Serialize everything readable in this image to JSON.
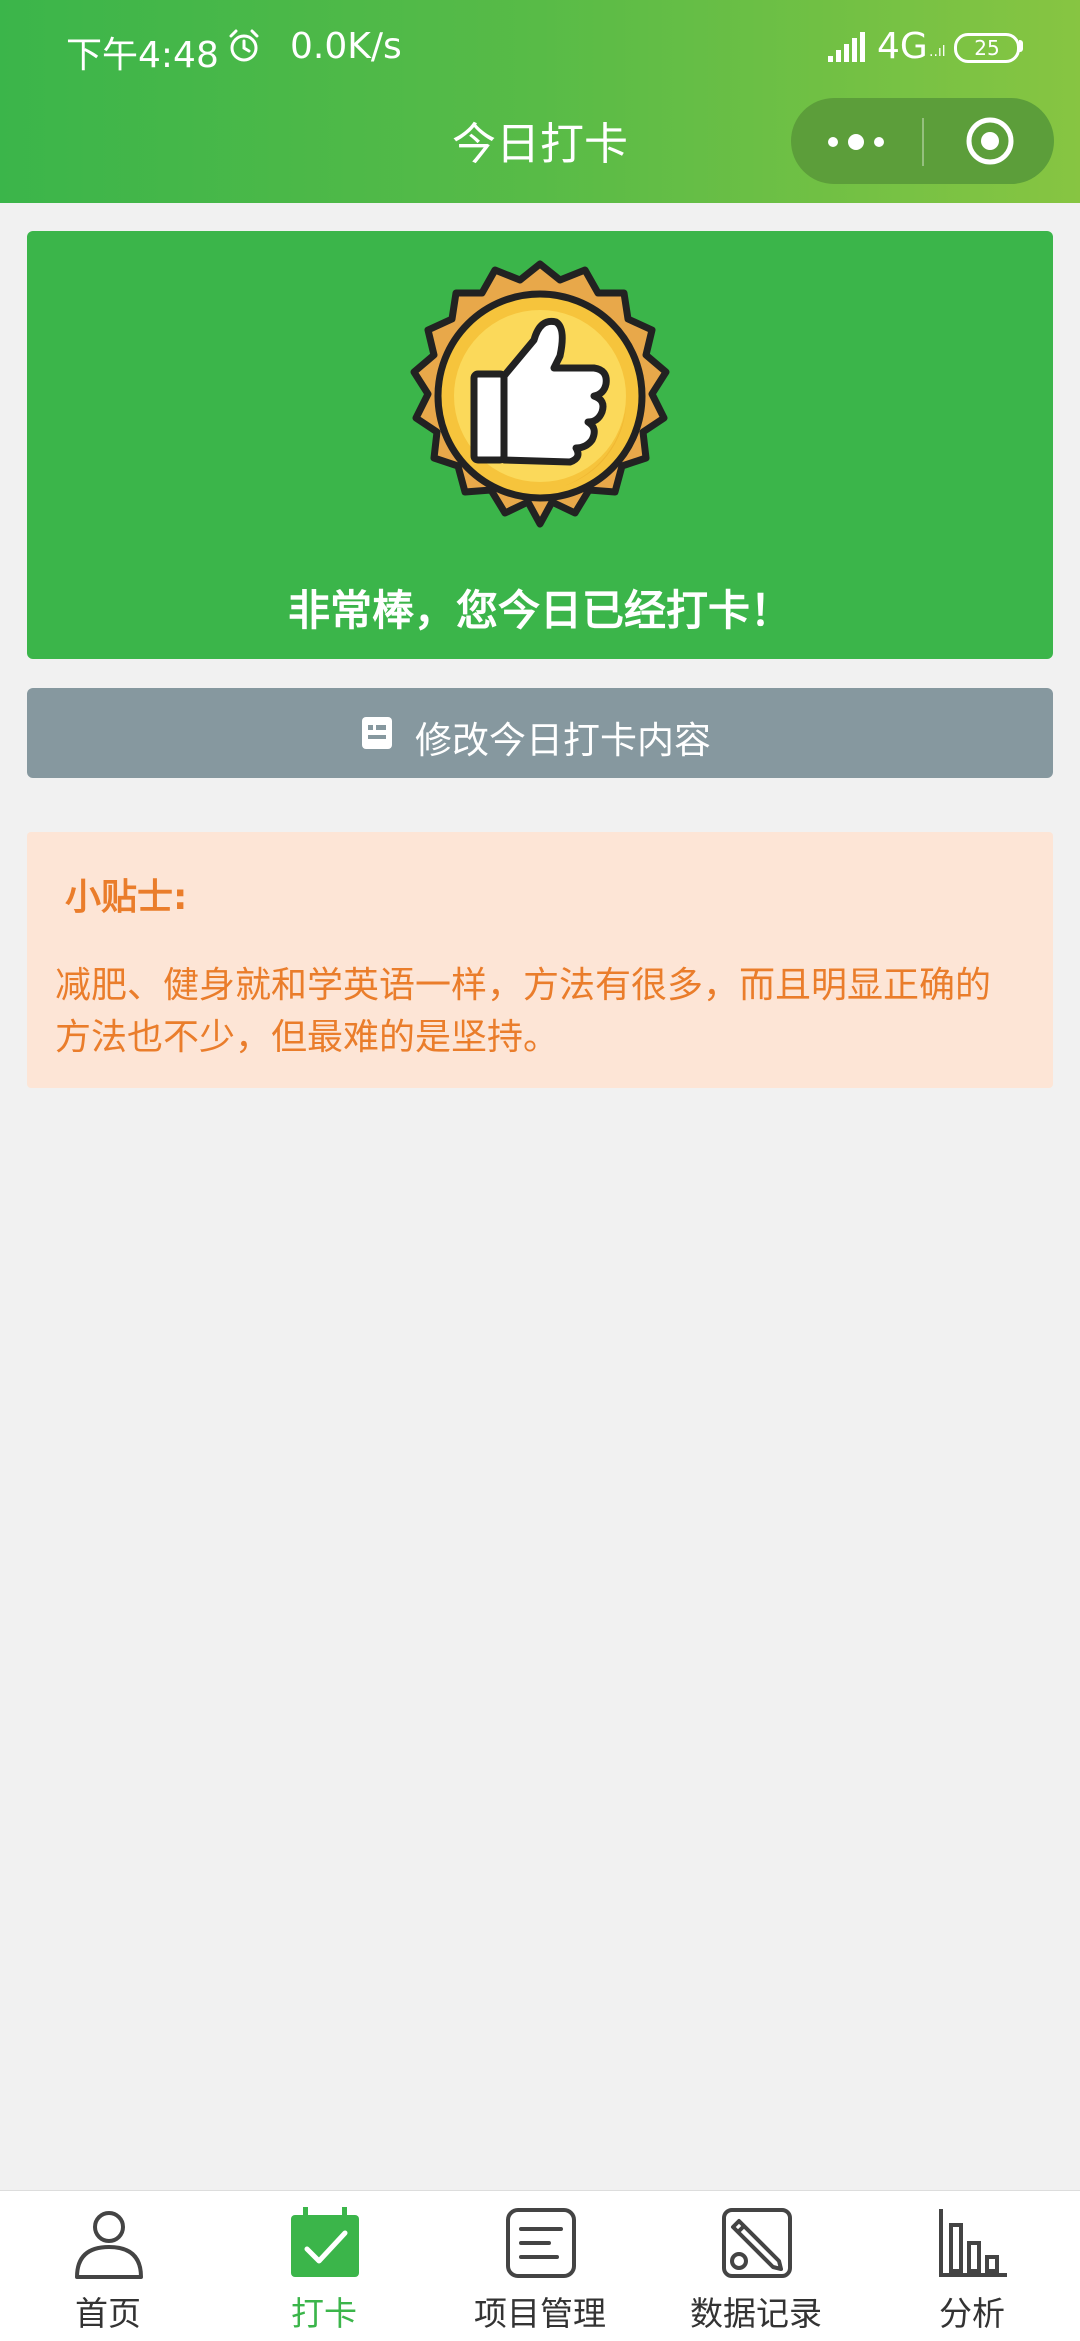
{
  "status_bar": {
    "time": "下午4:48",
    "net_speed": "0.0K/s",
    "network": "4G",
    "network_sub": "..ıl",
    "battery": "25"
  },
  "nav": {
    "title": "今日打卡"
  },
  "success": {
    "message": "非常棒，您今日已经打卡！"
  },
  "edit_button": {
    "label": "修改今日打卡内容"
  },
  "tips": {
    "title": "小贴士:",
    "body": "减肥、健身就和学英语一样，方法有很多，而且明显正确的方法也不少，但最难的是坚持。"
  },
  "tabbar": {
    "active_index": 1,
    "items": [
      {
        "label": "首页",
        "icon": "user-icon"
      },
      {
        "label": "打卡",
        "icon": "calendar-check-icon"
      },
      {
        "label": "项目管理",
        "icon": "list-icon"
      },
      {
        "label": "数据记录",
        "icon": "edit-record-icon"
      },
      {
        "label": "分析",
        "icon": "bar-chart-icon"
      }
    ]
  },
  "colors": {
    "brand_green": "#3bb54a",
    "tip_orange": "#ea7d2b",
    "tip_bg": "#fde5d6",
    "button_gray": "#86989f"
  }
}
